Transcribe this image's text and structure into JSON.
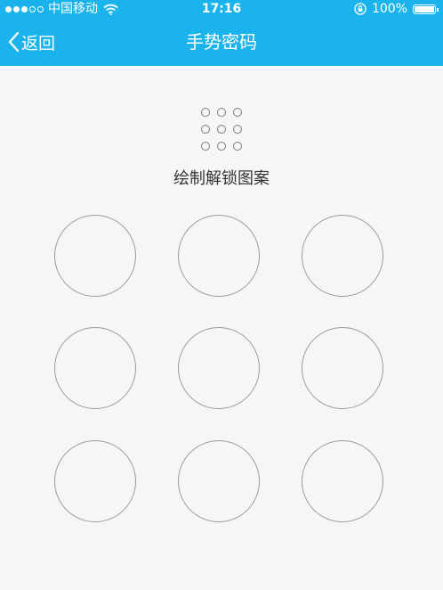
{
  "status_bar": {
    "carrier": "中国移动",
    "time": "17:16",
    "battery_text": "100%",
    "battery_level": 1.0,
    "signal_bars_total": 5,
    "signal_bars_filled": 3,
    "icons": [
      "signal-icon",
      "wifi-icon",
      "rotation-lock-icon",
      "battery-icon"
    ]
  },
  "nav": {
    "back_label": "返回",
    "title": "手势密码"
  },
  "gesture": {
    "hint": "绘制解锁图案",
    "node_count": 9
  },
  "colors": {
    "header_background": "#1ab3ec",
    "page_background": "#f6f5f8",
    "circle_border": "#9a9a9a"
  }
}
